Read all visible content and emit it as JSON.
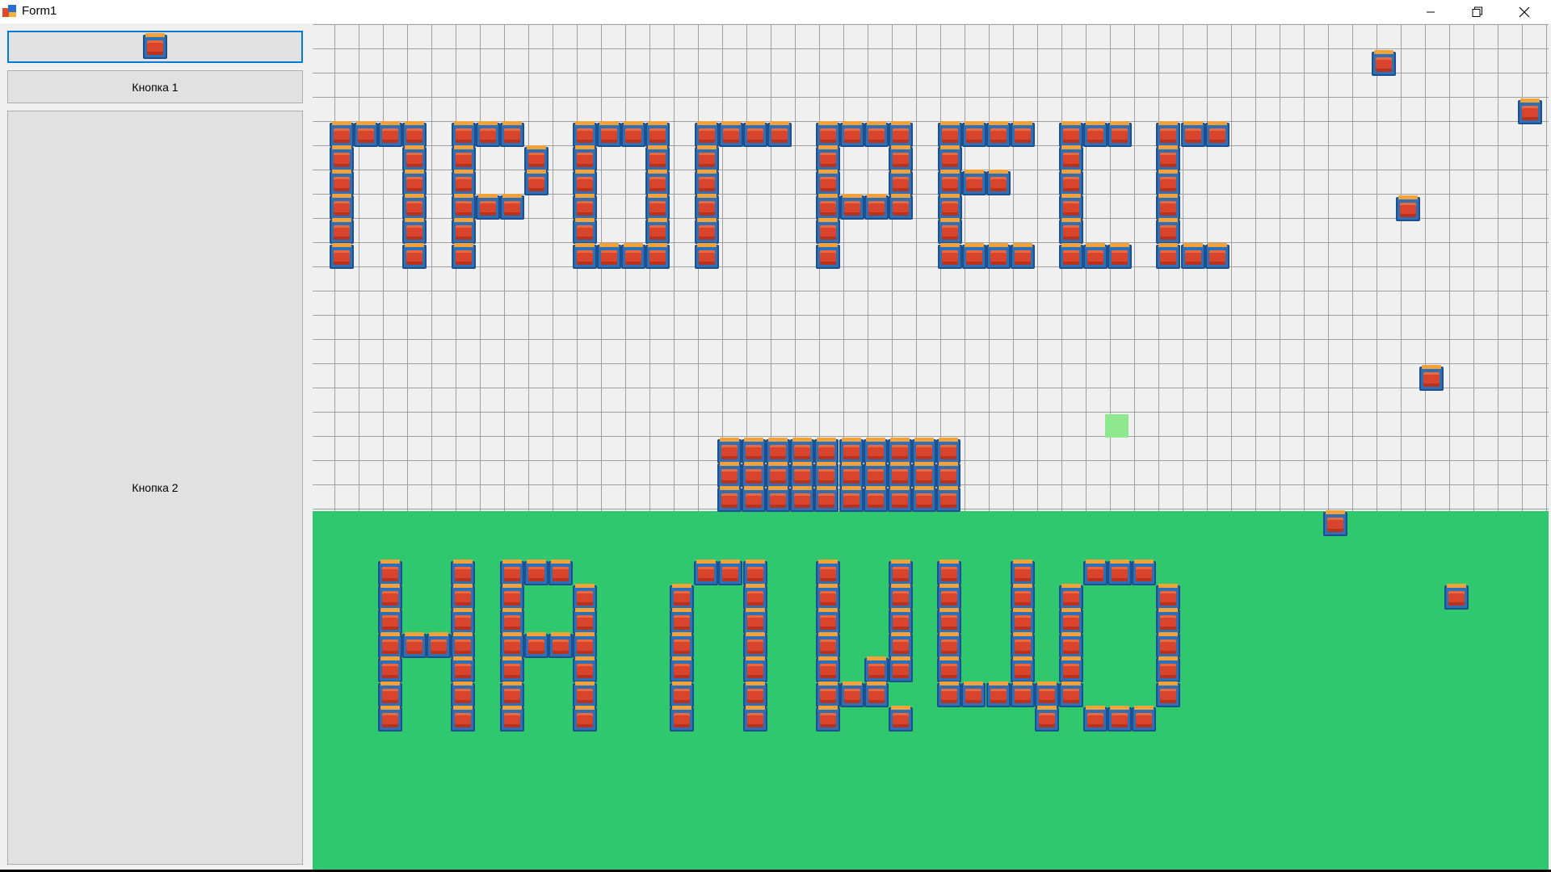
{
  "window": {
    "title": "Form1",
    "icons": {
      "app": "winforms-app-icon",
      "minimize": "minimize-icon",
      "maximize": "restore-icon",
      "close": "close-icon"
    }
  },
  "left_panel": {
    "top_button_icon": "crate-icon",
    "button1_label": "Кнопка 1",
    "button2_label": "Кнопка 2"
  },
  "board": {
    "grid_line_color": "#a0a0a0",
    "grass_color": "#2fc86e",
    "highlight_color": "#8ee88e",
    "block_icon": "crate-icon",
    "text_row1_pattern": [
      "####.###..####.####.####.####.###.###",
      "#..#.#..#.#..#.#....#..#.#....#...#..",
      "#..#.#..#.#..#.#....#..#.###..#...#..",
      "#..#.###..#..#.#....####.#....#...#..",
      "#..#.#....#..#.#....#....#....#...#..",
      "#..#.#....####.#....#....####.###.###"
    ],
    "text_row2_pattern": [
      "#..#.###.....###..#..#.#..#..###.",
      "#..#.#..#...#..#..#..#.#..#.#...#",
      "#..#.#..#...#..#..#..#.#..#.#...#",
      "####.####...#..#..#..#.#..#.#...#",
      "#..#.#..#...#..#..#.##.#..#.#...#",
      "#..#.#..#...#..#..###..######...#",
      "#..#.#..#...#..#..#..#.....#.###."
    ]
  }
}
